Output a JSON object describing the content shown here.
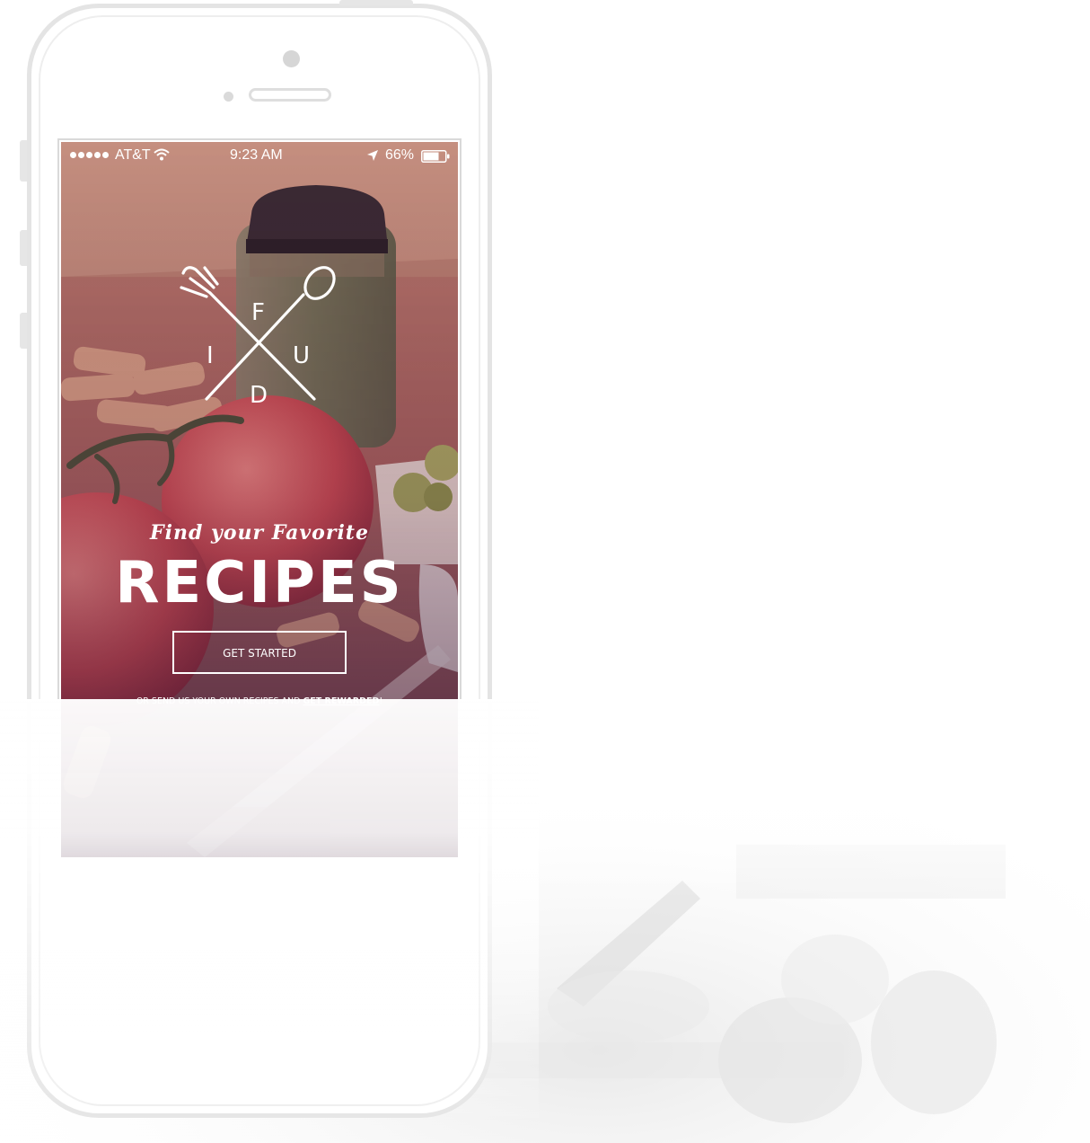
{
  "status_bar": {
    "carrier": "AT&T",
    "time": "9:23 AM",
    "battery": "66%"
  },
  "logo": {
    "letters": [
      "F",
      "I",
      "U",
      "D"
    ]
  },
  "hero": {
    "tagline": "Find your Favorite",
    "headline": "RECIPES",
    "cta_label": "GET STARTED",
    "footnote_prefix": "OR SEND US YOUR OWN RECIPES AND ",
    "footnote_link": "GET REWARDED",
    "footnote_suffix": "!"
  },
  "colors": {
    "overlay_top": "#c07a6a",
    "overlay_bottom": "#6e3b57",
    "tomato": "#c4484f",
    "phone_frame": "#e4e4e4"
  },
  "icons": [
    "wifi-icon",
    "location-arrow-icon",
    "battery-icon",
    "fork-icon",
    "spoon-icon"
  ]
}
